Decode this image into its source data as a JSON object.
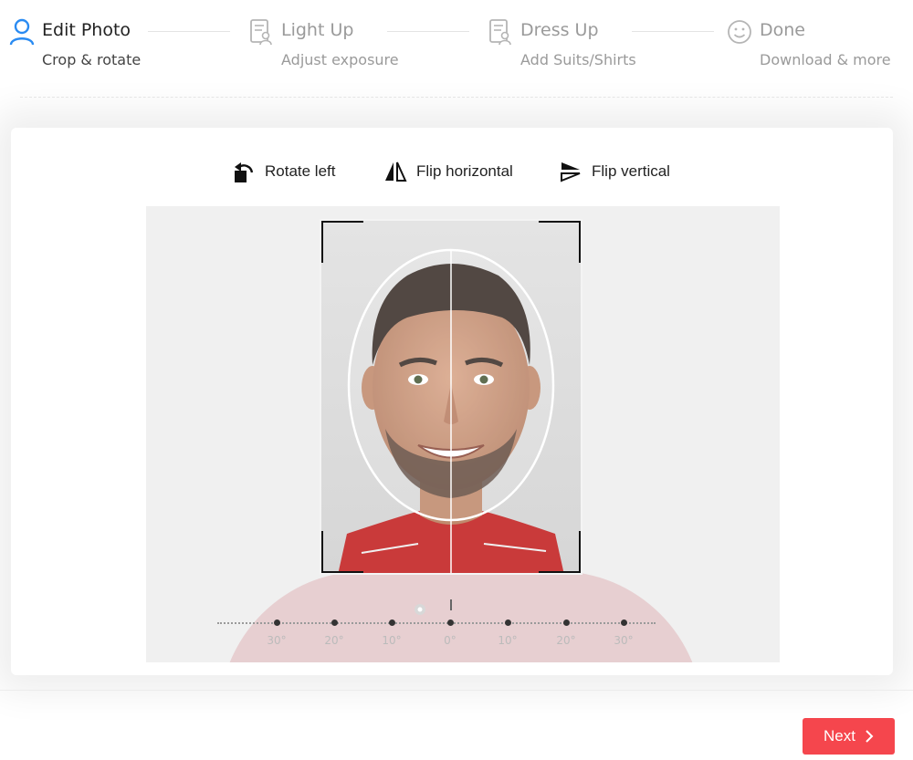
{
  "steps": [
    {
      "title": "Edit Photo",
      "subtitle": "Crop & rotate",
      "icon": "user-icon",
      "active": true
    },
    {
      "title": "Light Up",
      "subtitle": "Adjust exposure",
      "icon": "document-person-icon",
      "active": false
    },
    {
      "title": "Dress Up",
      "subtitle": "Add Suits/Shirts",
      "icon": "document-person-icon",
      "active": false
    },
    {
      "title": "Done",
      "subtitle": "Download & more",
      "icon": "smiley-icon",
      "active": false
    }
  ],
  "toolbar": {
    "rotate_left": "Rotate left",
    "flip_horizontal": "Flip horizontal",
    "flip_vertical": "Flip vertical"
  },
  "ruler": {
    "labels": [
      "30°",
      "20°",
      "10°",
      "0°",
      "10°",
      "20°",
      "30°"
    ],
    "angle": 0
  },
  "footer": {
    "next_label": "Next"
  },
  "colors": {
    "accent": "#2a8bf2",
    "primary_button": "#f5464d",
    "shirt": "#c93a3a"
  }
}
